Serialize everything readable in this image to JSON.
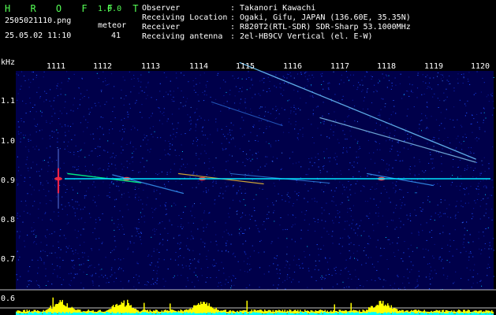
{
  "app": {
    "name": "H R O F F T",
    "version": "1.0.0"
  },
  "file": {
    "name": "2505021110.png",
    "datetime": "25.05.02 11:10"
  },
  "meteor": {
    "label": "meteor",
    "count": "41"
  },
  "info": [
    {
      "label": "Observer",
      "value": "Takanori Kawachi"
    },
    {
      "label": "Receiving Location",
      "value": "Ogaki, Gifu, JAPAN (136.60E, 35.35N)"
    },
    {
      "label": "Receiver",
      "value": "R820T2(RTL-SDR) SDR-Sharp 53.1000MHz"
    },
    {
      "label": "Receiving antenna",
      "value": "2el-HB9CV Vertical (el. E-W)"
    }
  ],
  "colors": {
    "title_green": "#55ff55",
    "carrier_cyan": "#00e5ff",
    "level_yellow": "#ffff00",
    "level_cyan": "#00ffff",
    "background_blue": "#00004a"
  },
  "chart_data": {
    "type": "heatmap",
    "ylabel": "kHz",
    "y_ticks": [
      "1.1",
      "1.0",
      "0.9",
      "0.8",
      "0.7",
      "0.6"
    ],
    "x_ticks": [
      "1111",
      "1112",
      "1113",
      "1114",
      "1115",
      "1116",
      "1117",
      "1118",
      "1119",
      "1120"
    ],
    "carrier_khz": 0.905,
    "meteor_echoes_time": [
      1111.1,
      1112.5,
      1114.1,
      1117.9
    ],
    "level_peaks_time": [
      1111.1,
      1112.4,
      1114.1,
      1117.9
    ],
    "legend": "none"
  }
}
